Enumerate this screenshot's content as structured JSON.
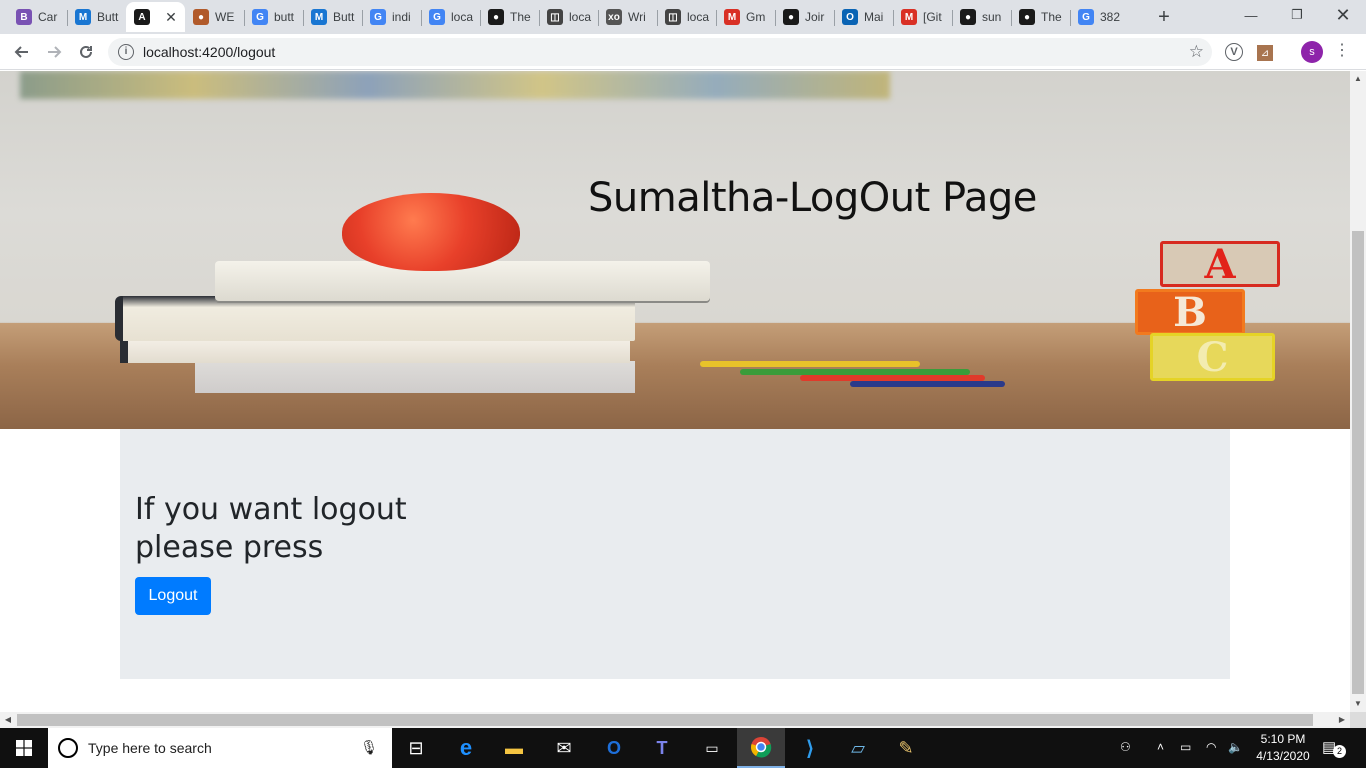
{
  "browser": {
    "tabs": [
      {
        "title": "Car",
        "favicon": "bootstrap-icon",
        "color": "#7952b3",
        "glyph": "B"
      },
      {
        "title": "Butt",
        "favicon": "angular-material-icon",
        "color": "#1976d2",
        "glyph": "M"
      },
      {
        "title": "",
        "favicon": "angular-icon",
        "color": "#1a1a1a",
        "glyph": "A",
        "active": true
      },
      {
        "title": "WE",
        "favicon": "site-emblem-icon",
        "color": "#b15a2a",
        "glyph": "●"
      },
      {
        "title": "butt",
        "favicon": "google-icon",
        "color": "#4285f4",
        "glyph": "G"
      },
      {
        "title": "Butt",
        "favicon": "angular-material-icon",
        "color": "#1976d2",
        "glyph": "M"
      },
      {
        "title": "indi",
        "favicon": "google-icon",
        "color": "#4285f4",
        "glyph": "G"
      },
      {
        "title": "loca",
        "favicon": "google-icon",
        "color": "#4285f4",
        "glyph": "G"
      },
      {
        "title": "The",
        "favicon": "github-icon",
        "color": "#1a1a1a",
        "glyph": "●"
      },
      {
        "title": "loca",
        "favicon": "local-server-icon",
        "color": "#444444",
        "glyph": "◫"
      },
      {
        "title": "Wri",
        "favicon": "xo-icon",
        "color": "#555555",
        "glyph": "xo"
      },
      {
        "title": "loca",
        "favicon": "local-server-icon",
        "color": "#444444",
        "glyph": "◫"
      },
      {
        "title": "Gm",
        "favicon": "gmail-icon",
        "color": "#d93025",
        "glyph": "M"
      },
      {
        "title": "Joir",
        "favicon": "github-icon",
        "color": "#1a1a1a",
        "glyph": "●"
      },
      {
        "title": "Mai",
        "favicon": "outlook-icon",
        "color": "#0a64b4",
        "glyph": "O"
      },
      {
        "title": "[Git",
        "favicon": "gmail-icon",
        "color": "#d93025",
        "glyph": "M"
      },
      {
        "title": "sun",
        "favicon": "github-icon",
        "color": "#1a1a1a",
        "glyph": "●"
      },
      {
        "title": "The",
        "favicon": "github-icon",
        "color": "#1a1a1a",
        "glyph": "●"
      },
      {
        "title": "382",
        "favicon": "google-icon",
        "color": "#4285f4",
        "glyph": "G"
      }
    ],
    "url": "localhost:4200/logout",
    "profile_initial": "s"
  },
  "page": {
    "hero_title": "Sumaltha-LogOut Page",
    "block_letters": [
      "A",
      "B",
      "C"
    ],
    "prompt": "If you want logout please press",
    "logout_label": "Logout",
    "colors": {
      "button": "#007bff",
      "panel": "#e9ecef"
    }
  },
  "taskbar": {
    "search_placeholder": "Type here to search",
    "time": "5:10 PM",
    "date": "4/13/2020",
    "notification_count": "2"
  }
}
